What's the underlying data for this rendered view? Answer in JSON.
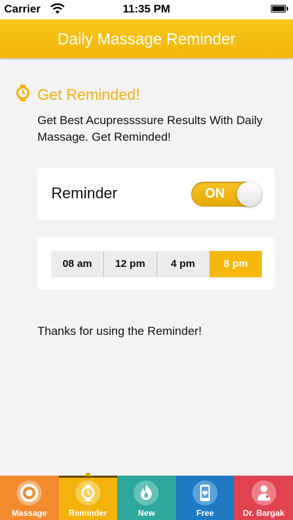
{
  "status_bar": {
    "carrier": "Carrier",
    "time": "11:35 PM"
  },
  "header": {
    "title": "Daily Massage Reminder"
  },
  "section": {
    "icon": "watch-icon",
    "title": "Get Reminded!",
    "description": "Get Best Acupressssure Results With Daily Massage. Get Reminded!"
  },
  "reminder": {
    "label": "Reminder",
    "toggle_text": "ON",
    "enabled": true
  },
  "times": {
    "options": [
      "08 am",
      "12 pm",
      "4 pm",
      "8 pm"
    ],
    "selected": "8 pm"
  },
  "thanks": "Thanks for using the Reminder!",
  "tabs": [
    {
      "label": "Massage",
      "icon": "target-icon",
      "color": "#f28a2e",
      "active": false
    },
    {
      "label": "Reminder",
      "icon": "watch-icon",
      "color": "#f4b30c",
      "active": true
    },
    {
      "label": "New",
      "icon": "flame-icon",
      "color": "#2ea79d",
      "active": false
    },
    {
      "label": "Free",
      "icon": "phone-heart-icon",
      "color": "#1f79c3",
      "active": false
    },
    {
      "label": "Dr. Bargak",
      "icon": "doctor-icon",
      "color": "#e0424f",
      "active": false
    }
  ],
  "colors": {
    "accent": "#f4b30c",
    "title_color": "#f2b10d",
    "background": "#f3f3f3"
  }
}
